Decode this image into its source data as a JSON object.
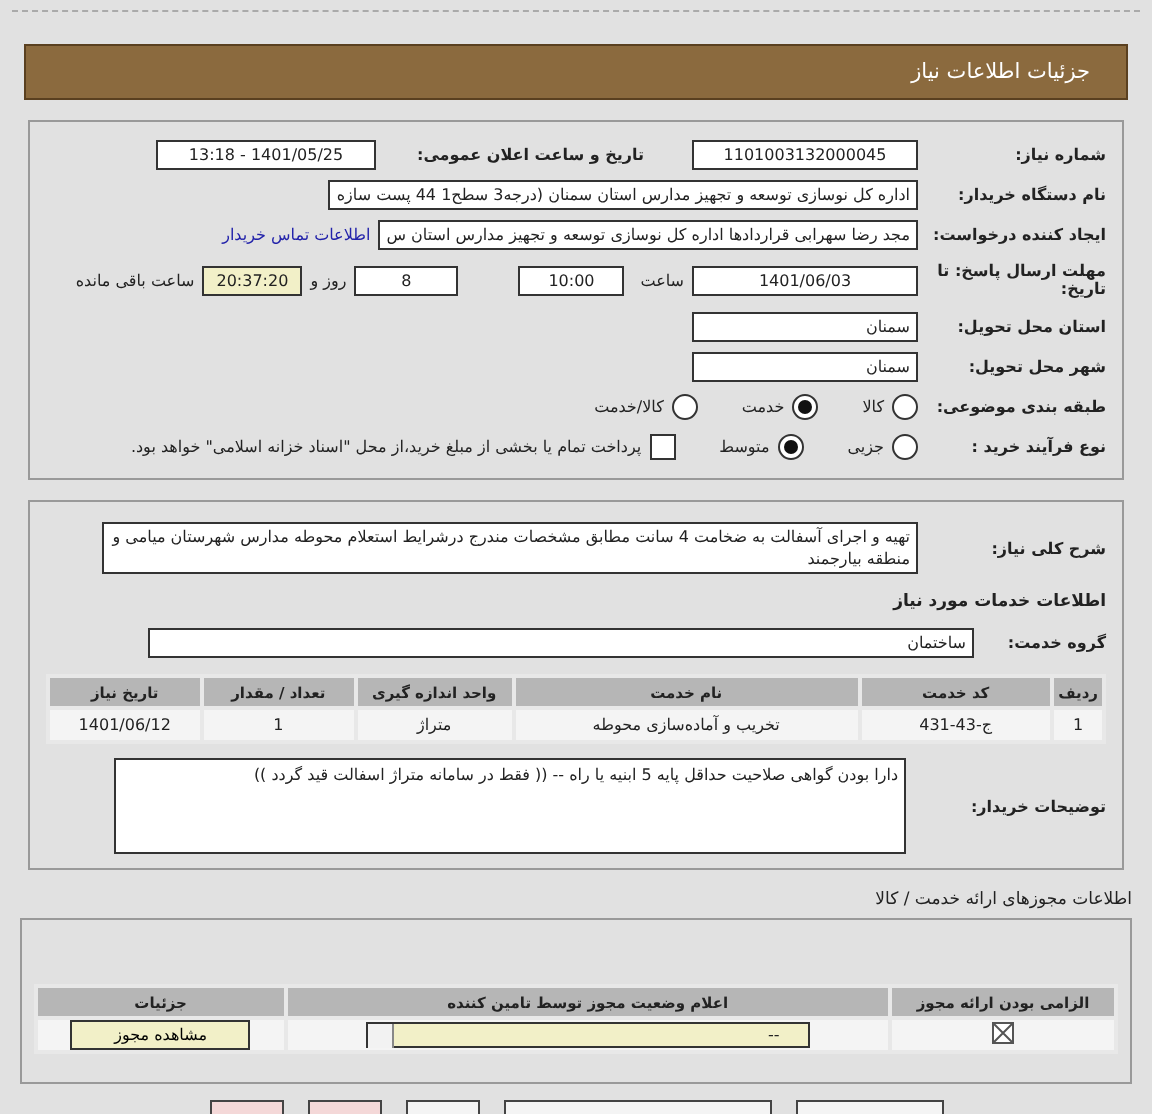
{
  "header": {
    "title": "جزئیات اطلاعات نیاز"
  },
  "details": {
    "need_number": {
      "label": "شماره نیاز:",
      "value": "1101003132000045"
    },
    "announce": {
      "label": "تاریخ و ساعت اعلان عمومی:",
      "value": "1401/05/25 - 13:18"
    },
    "buyer": {
      "label": "نام دستگاه خریدار:",
      "value": "اداره کل نوسازی   توسعه و تجهیز مدارس استان سمنان (درجه3  سطح1  44 پست سازه"
    },
    "requester": {
      "label": "ایجاد کننده درخواست:",
      "value": "مجد رضا سهرابی قراردادها اداره کل نوسازی   توسعه و تجهیز مدارس استان س",
      "link": "اطلاعات تماس خریدار"
    },
    "deadline": {
      "label": "مهلت ارسال پاسخ: تا تاریخ:",
      "date": "1401/06/03",
      "time_label": "ساعت",
      "time": "10:00",
      "days": "8",
      "days_label": "روز و",
      "remaining": "20:37:20",
      "remaining_label": "ساعت باقی مانده"
    },
    "province": {
      "label": "استان محل تحویل:",
      "value": "سمنان"
    },
    "city": {
      "label": "شهر محل تحویل:",
      "value": "سمنان"
    },
    "category": {
      "label": "طبقه بندی موضوعی:",
      "options": [
        {
          "label": "کالا",
          "selected": false
        },
        {
          "label": "خدمت",
          "selected": true
        },
        {
          "label": "کالا/خدمت",
          "selected": false
        }
      ]
    },
    "process": {
      "label": "نوع فرآیند خرید :",
      "options": [
        {
          "label": "جزیی",
          "selected": false
        },
        {
          "label": "متوسط",
          "selected": true
        }
      ],
      "payment": {
        "label": "پرداخت تمام یا بخشی از مبلغ خرید،از محل \"اسناد خزانه اسلامی\" خواهد بود.",
        "checked": false
      }
    }
  },
  "needs": {
    "description": {
      "label": "شرح کلی نیاز:",
      "value": "تهیه و اجرای آسفالت به ضخامت 4 سانت مطابق مشخصات مندرج درشرایط استعلام  محوطه مدارس شهرستان میامی و منطقه بیارجمند"
    },
    "section_title": "اطلاعات خدمات مورد نیاز",
    "group": {
      "label": "گروه خدمت:",
      "value": "ساختمان"
    },
    "table": {
      "columns": [
        "ردیف",
        "کد خدمت",
        "نام خدمت",
        "واحد اندازه گیری",
        "تعداد / مقدار",
        "تاریخ نیاز"
      ],
      "rows": [
        [
          "1",
          "ج-43-431",
          "تخریب و آماده‌سازی محوطه",
          "متراژ",
          "1",
          "1401/06/12"
        ]
      ]
    },
    "notes": {
      "label": "توضیحات خریدار:",
      "value": "دارا بودن گواهی صلاحیت  حداقل پایه 5 ابنیه یا  راه -- ((  فقط در سامانه  متراژ اسفالت   قید گردد ))"
    }
  },
  "licenses": {
    "title": "اطلاعات مجوزهای ارائه خدمت / کالا",
    "columns": [
      "الزامی بودن ارائه مجوز",
      "اعلام وضعیت مجوز توسط تامین کننده",
      "جزئیات"
    ],
    "rows": [
      {
        "required": true,
        "status": "--",
        "button": "مشاهده مجوز"
      }
    ]
  },
  "bottom_buttons": [
    {
      "color": "#f4f4f4"
    },
    {
      "color": "#f4f4f4"
    },
    {
      "color": "#f4f4f4"
    },
    {
      "color": "#f4d8d8"
    },
    {
      "color": "#f4d8d8"
    }
  ]
}
